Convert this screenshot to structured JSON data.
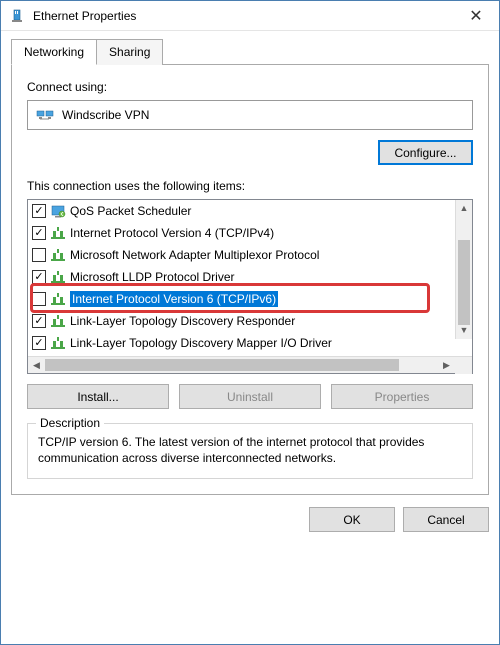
{
  "titlebar": {
    "title": "Ethernet Properties"
  },
  "tabs": {
    "networking": "Networking",
    "sharing": "Sharing"
  },
  "connect": {
    "label": "Connect using:",
    "adapter": "Windscribe VPN"
  },
  "buttons": {
    "configure": "Configure...",
    "install": "Install...",
    "uninstall": "Uninstall",
    "properties": "Properties",
    "ok": "OK",
    "cancel": "Cancel"
  },
  "items": {
    "label": "This connection uses the following items:",
    "list": [
      {
        "checked": true,
        "label": "QoS Packet Scheduler",
        "icon": "app"
      },
      {
        "checked": true,
        "label": "Internet Protocol Version 4 (TCP/IPv4)",
        "icon": "proto"
      },
      {
        "checked": false,
        "label": "Microsoft Network Adapter Multiplexor Protocol",
        "icon": "proto"
      },
      {
        "checked": true,
        "label": "Microsoft LLDP Protocol Driver",
        "icon": "proto"
      },
      {
        "checked": false,
        "label": "Internet Protocol Version 6 (TCP/IPv6)",
        "icon": "proto",
        "selected": true
      },
      {
        "checked": true,
        "label": "Link-Layer Topology Discovery Responder",
        "icon": "proto"
      },
      {
        "checked": true,
        "label": "Link-Layer Topology Discovery Mapper I/O Driver",
        "icon": "proto"
      }
    ]
  },
  "description": {
    "legend": "Description",
    "text": "TCP/IP version 6. The latest version of the internet protocol that provides communication across diverse interconnected networks."
  }
}
